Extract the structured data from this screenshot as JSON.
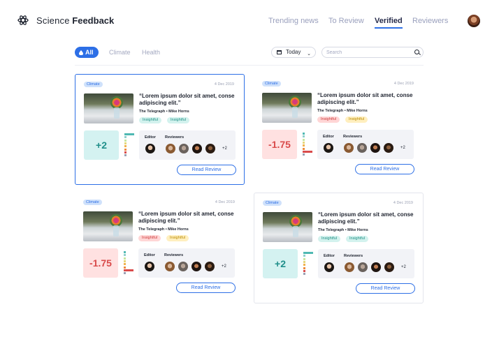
{
  "brand": {
    "name_light": "Science",
    "name_bold": "Feedback"
  },
  "nav": [
    "Trending news",
    "To Review",
    "Verified",
    "Reviewers"
  ],
  "nav_active": "Verified",
  "filters": {
    "all": "All",
    "items": [
      "Climate",
      "Health"
    ]
  },
  "date_filter": "Today",
  "search": {
    "placeholder": "Search",
    "value": ""
  },
  "colors": {
    "accent": "#2d6fe6",
    "positive": "#1f8f8a",
    "negative": "#d94b4b"
  },
  "icons": {
    "logo": "science-feedback-logo-icon",
    "drop": "drop-icon",
    "calendar": "calendar-icon",
    "search": "search-icon"
  },
  "cards": [
    {
      "tag": "Climate",
      "date": "4 Dec 2019",
      "headline": "“Lorem ipsum dolor sit amet, conse adipiscing elit.”",
      "source": "The Telegraph • Mike Horns",
      "chips": [
        {
          "label": "Insightful",
          "color": "teal"
        },
        {
          "label": "Insightful",
          "color": "teal"
        }
      ],
      "score": "+2",
      "score_value": 2,
      "editor_label": "Editor",
      "reviewers_label": "Reviewers",
      "more": "+2",
      "button": "Read Review"
    },
    {
      "tag": "Climate",
      "date": "4 Dec 2019",
      "headline": "“Lorem ipsum dolor sit amet, conse adipiscing elit.”",
      "source": "The Telegraph • Mike Horns",
      "chips": [
        {
          "label": "Insightful",
          "color": "red"
        },
        {
          "label": "Insightful",
          "color": "yellow"
        }
      ],
      "score": "-1.75",
      "score_value": -1.75,
      "editor_label": "Editor",
      "reviewers_label": "Reviewers",
      "more": "+2",
      "button": "Read Review"
    },
    {
      "tag": "Climate",
      "date": "4 Dec 2019",
      "headline": "“Lorem ipsum dolor sit amet, conse adipiscing elit.”",
      "source": "The Telegraph • Mike Horns",
      "chips": [
        {
          "label": "Insightful",
          "color": "red"
        },
        {
          "label": "Insightful",
          "color": "yellow"
        }
      ],
      "score": "-1.75",
      "score_value": -1.75,
      "editor_label": "Editor",
      "reviewers_label": "Reviewers",
      "more": "+2",
      "button": "Read Review"
    },
    {
      "tag": "Climate",
      "date": "4 Dec 2019",
      "headline": "“Lorem ipsum dolor sit amet, conse adipiscing elit.”",
      "source": "The Telegraph • Mike Horns",
      "chips": [
        {
          "label": "Insightful",
          "color": "teal"
        },
        {
          "label": "Insightful",
          "color": "teal"
        }
      ],
      "score": "+2",
      "score_value": 2,
      "editor_label": "Editor",
      "reviewers_label": "Reviewers",
      "more": "+2",
      "button": "Read Review"
    }
  ]
}
